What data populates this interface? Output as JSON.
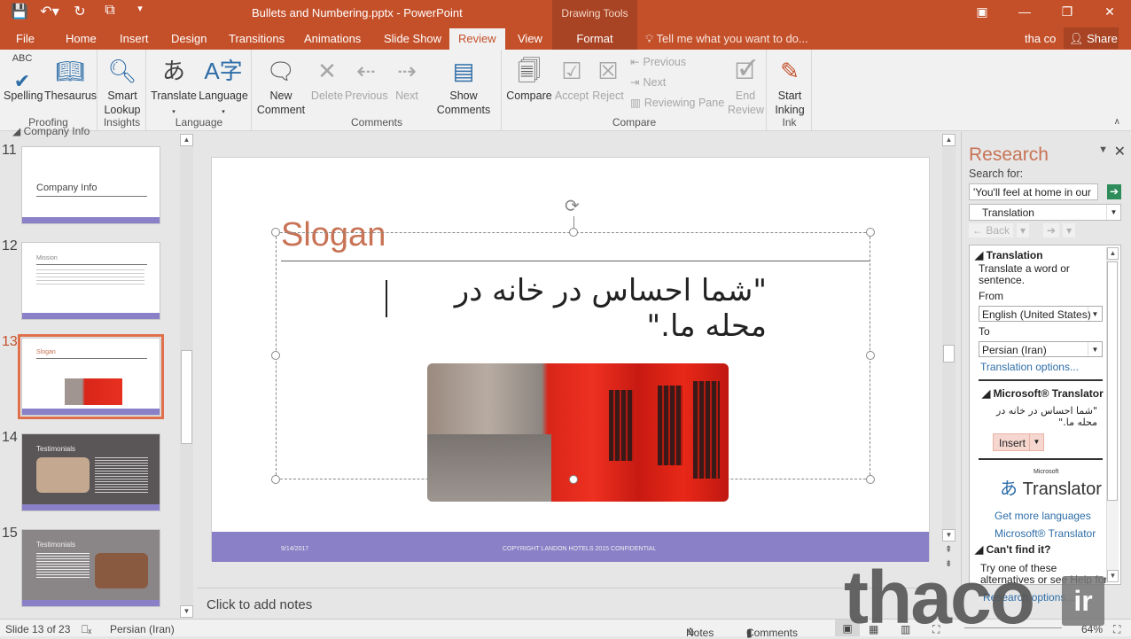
{
  "window": {
    "title": "Bullets and Numbering.pptx - PowerPoint",
    "context_tab_group": "Drawing Tools",
    "controls": {
      "ribbon_display": "▣",
      "minimize": "—",
      "restore": "❐",
      "close": "✕"
    }
  },
  "qat": {
    "save": "💾",
    "undo": "↶▾",
    "redo": "↻",
    "present": "⧉",
    "customize": "▾"
  },
  "tabs": [
    {
      "label": "File"
    },
    {
      "label": "Home"
    },
    {
      "label": "Insert"
    },
    {
      "label": "Design"
    },
    {
      "label": "Transitions"
    },
    {
      "label": "Animations"
    },
    {
      "label": "Slide Show"
    },
    {
      "label": "Review",
      "active": true
    },
    {
      "label": "View"
    },
    {
      "label": "Format"
    }
  ],
  "tell_me": "Tell me what you want to do...",
  "user": "tha co",
  "share": "Share",
  "ribbon": {
    "proofing": {
      "label": "Proofing",
      "spelling": "Spelling",
      "thesaurus": "Thesaurus"
    },
    "insights": {
      "label": "Insights",
      "smart_lookup": "Smart Lookup"
    },
    "language": {
      "label": "Language",
      "translate": "Translate",
      "language": "Language"
    },
    "comments": {
      "label": "Comments",
      "new_comment": "New Comment",
      "delete": "Delete",
      "previous": "Previous",
      "next": "Next",
      "show_comments": "Show Comments"
    },
    "compare": {
      "label": "Compare",
      "compare": "Compare",
      "accept": "Accept",
      "reject": "Reject",
      "previous": "Previous",
      "next": "Next",
      "reviewing_pane": "Reviewing Pane",
      "end_review": "End Review"
    },
    "ink": {
      "label": "Ink",
      "start_inking": "Start Inking"
    }
  },
  "slide_panel": {
    "section": "Company Info",
    "slides": [
      {
        "num": "11",
        "title": "Company Info"
      },
      {
        "num": "12",
        "title": "Mission"
      },
      {
        "num": "13",
        "title": "Slogan",
        "selected": true
      },
      {
        "num": "14",
        "title": "Testimonials"
      },
      {
        "num": "15",
        "title": "Testimonials"
      }
    ]
  },
  "slide": {
    "title": "Slogan",
    "body": "\"شما احساس در خانه در محله ما.\"",
    "footer_date": "9/14/2017",
    "footer_text": "COPYRIGHT LANDON HOTELS 2015 CONFIDENTIAL"
  },
  "notes_placeholder": "Click to add notes",
  "research": {
    "title": "Research",
    "search_label": "Search for:",
    "search_value": "'You'll feel at home in our",
    "service": "Translation",
    "back": "← Back",
    "section_translation": "Translation",
    "desc": "Translate a word or sentence.",
    "from_label": "From",
    "from_value": "English (United States)",
    "to_label": "To",
    "to_value": "Persian (Iran)",
    "options_link": "Translation options...",
    "ms_translator_header": "Microsoft® Translator",
    "result": "\"شما احساس در خانه در محله ما.\"",
    "insert": "Insert",
    "logo_small": "Microsoft",
    "logo_text": "Translator",
    "get_more": "Get more languages",
    "ms_link": "Microsoft® Translator",
    "cant_find": "Can't find it?",
    "try_text": "Try one of these alternatives or see Help for",
    "research_options": "Research options..."
  },
  "status": {
    "slide_info": "Slide 13 of 23",
    "language": "Persian (Iran)",
    "notes": "Notes",
    "comments": "Comments",
    "zoom": "64%"
  },
  "watermark": {
    "text": "thaco",
    "suffix": "ir"
  }
}
